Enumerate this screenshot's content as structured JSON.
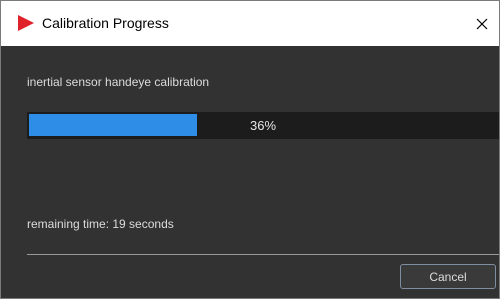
{
  "window": {
    "title": "Calibration Progress",
    "icon": "red-play-arrow-icon",
    "close_icon": "close-icon"
  },
  "task": {
    "label": "inertial sensor handeye calibration"
  },
  "progress": {
    "value": 36,
    "text": "36%"
  },
  "remaining": {
    "text": "remaining time: 19 seconds"
  },
  "actions": {
    "cancel_label": "Cancel"
  },
  "colors": {
    "accent": "#2e8de6",
    "icon_red": "#e0222b",
    "background": "#323232",
    "track": "#1c1c1c"
  }
}
